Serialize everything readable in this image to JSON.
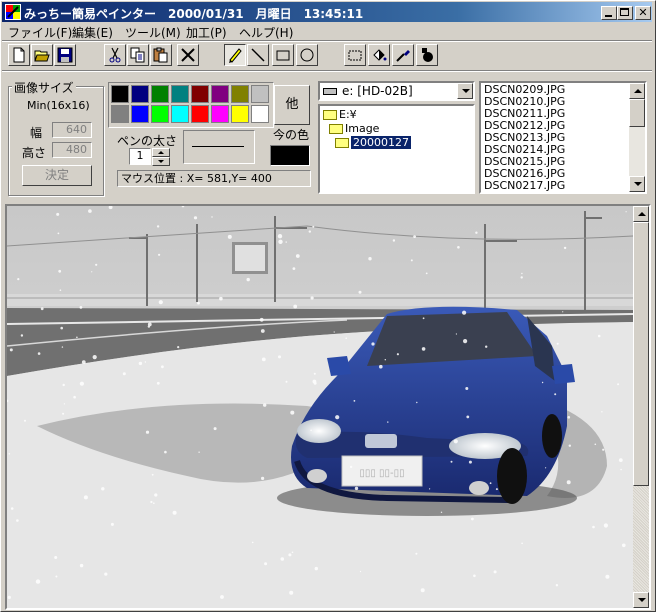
{
  "window": {
    "title": "みっちー簡易ペインター　2000/01/31　月曜日　13:45:11",
    "minimize_icon": "minimize-icon",
    "maximize_icon": "maximize-icon",
    "close_icon": "close-icon"
  },
  "menu": {
    "file": "ファイル(F)",
    "edit": "編集(E)",
    "tool": "ツール(M)",
    "process": "加工(P)",
    "help": "ヘルプ(H)"
  },
  "toolbar": [
    "new-file-icon",
    "open-folder-icon",
    "save-icon",
    "cut-icon",
    "copy-icon",
    "paste-icon",
    "delete-icon",
    "pencil-icon",
    "line-icon",
    "rectangle-icon",
    "ellipse-icon",
    "select-rect-icon",
    "fill-bucket-icon",
    "eyedropper-icon",
    "spray-icon"
  ],
  "image_size": {
    "title": "画像サイズ",
    "min_label": "Min(16x16)",
    "width_label": "幅",
    "width_value": "640",
    "height_label": "高さ",
    "height_value": "480",
    "apply_button": "決定"
  },
  "palette": {
    "colors": [
      "#000000",
      "#000080",
      "#008000",
      "#008080",
      "#800000",
      "#800080",
      "#808000",
      "#c0c0c0",
      "#808080",
      "#0000ff",
      "#00ff00",
      "#00ffff",
      "#ff0000",
      "#ff00ff",
      "#ffff00",
      "#ffffff"
    ],
    "other_button": "他"
  },
  "pen": {
    "thickness_label": "ペンの太さ",
    "thickness_value": "1",
    "current_color_label": "今の色",
    "current_color": "#000000"
  },
  "status": {
    "mouse_position": "マウス位置 : X= 581,Y= 400"
  },
  "drive": {
    "selected": "e: [HD-02B]"
  },
  "folders": [
    {
      "name": "E:¥",
      "selected": false
    },
    {
      "name": "Image",
      "selected": false
    },
    {
      "name": "20000127",
      "selected": true
    }
  ],
  "files": [
    "DSCN0209.JPG",
    "DSCN0210.JPG",
    "DSCN0211.JPG",
    "DSCN0212.JPG",
    "DSCN0213.JPG",
    "DSCN0214.JPG",
    "DSCN0215.JPG",
    "DSCN0216.JPG",
    "DSCN0217.JPG"
  ],
  "canvas": {
    "plate_text": "▯▯▯ ▯▯-▯▯"
  }
}
